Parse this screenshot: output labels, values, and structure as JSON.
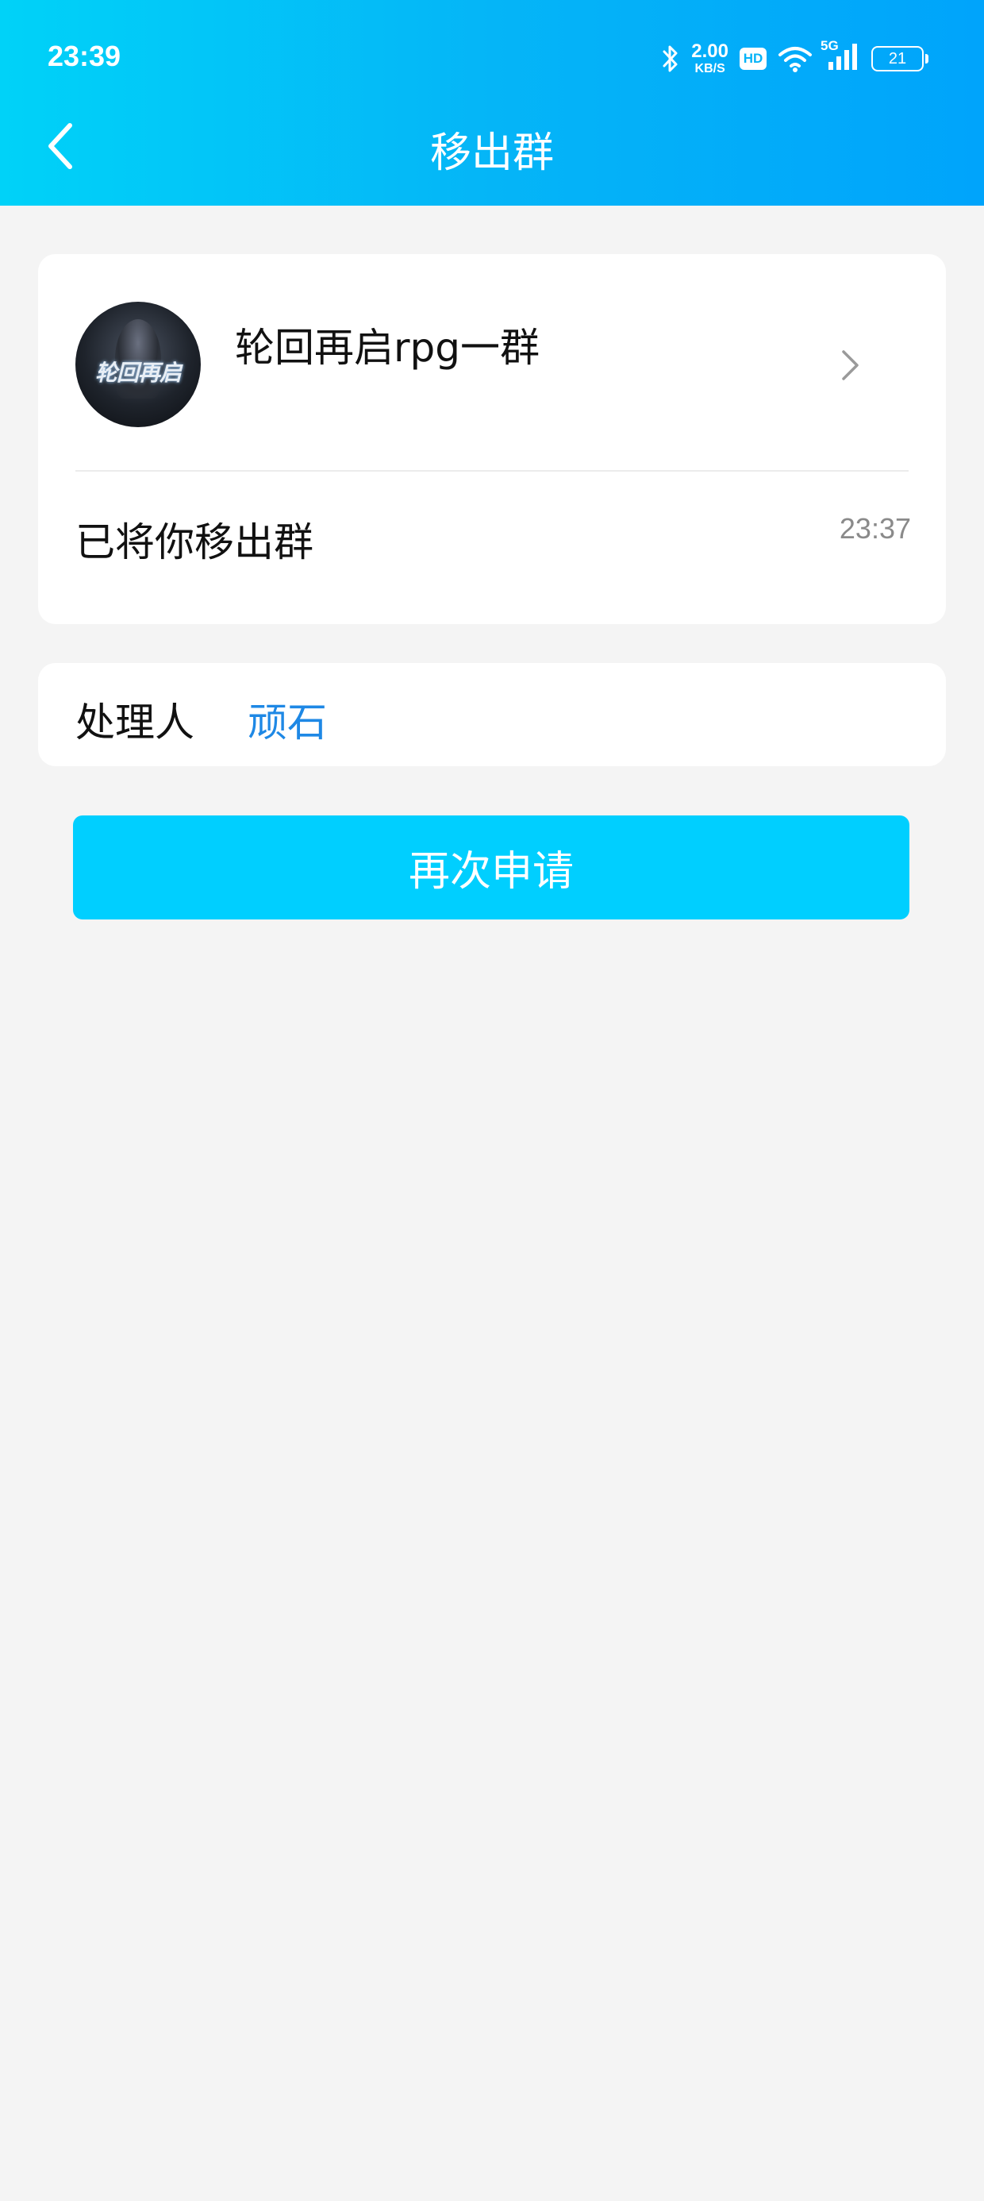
{
  "status_bar": {
    "time": "23:39",
    "net_speed_value": "2.00",
    "net_speed_unit": "KB/S",
    "hd_label": "HD",
    "network_label": "5G",
    "battery_level": "21",
    "icons": [
      "bluetooth-icon",
      "hd-icon",
      "wifi-icon",
      "signal-5g-icon",
      "battery-icon"
    ]
  },
  "header": {
    "title": "移出群",
    "back_icon": "chevron-left-icon",
    "background_gradient": [
      "#00d2f8",
      "#00a4fb"
    ]
  },
  "group_card": {
    "avatar_text": "轮回再启",
    "group_name": "轮回再启rpg一群",
    "chevron_icon": "chevron-right-icon",
    "message": "已将你移出群",
    "message_time": "23:37"
  },
  "handler_card": {
    "label": "处理人",
    "name": "顽石",
    "name_color": "#1e88e5"
  },
  "actions": {
    "reapply_label": "再次申请",
    "button_color": "#00cfff"
  }
}
